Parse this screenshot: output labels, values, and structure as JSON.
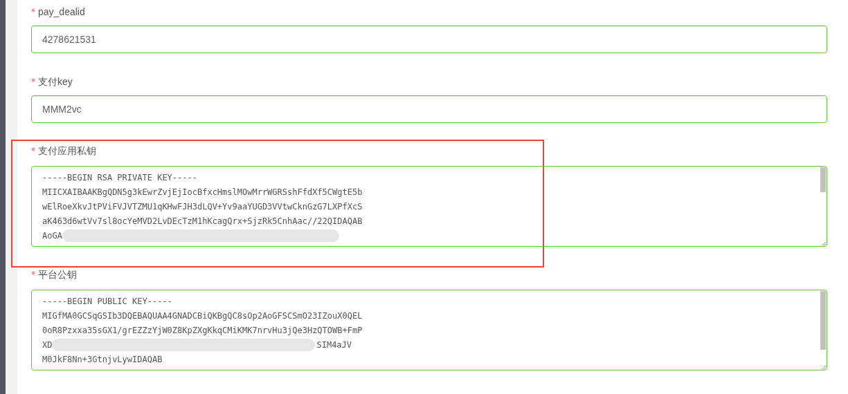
{
  "fields": [
    {
      "kind": "input",
      "label": "pay_dealid",
      "required": true,
      "value": "4278621531",
      "highlighted": false
    },
    {
      "kind": "input",
      "label": "支付key",
      "required": true,
      "value": "MMM2vc",
      "highlighted": false
    },
    {
      "kind": "textarea",
      "label": "支付应用私钥",
      "required": true,
      "highlighted": true,
      "lines": [
        {
          "kind": "text",
          "text": "-----BEGIN RSA PRIVATE KEY-----"
        },
        {
          "kind": "text",
          "text": "MIICXAIBAAKBgQDN5g3kEwrZvjEjIocBfxcHmslMOwMrrWGRSshFfdXf5CWgtE5b"
        },
        {
          "kind": "text",
          "text": "wElRoeXkvJtPViFVJVTZMU1qKHwFJH3dLQV+Yv9aaYUGD3VVtwCknGzG7LXPfXcS"
        },
        {
          "kind": "text",
          "text": "aK463d6wtVv7sl8ocYeMVD2LvDEcTzM1hKcagQrx+SjzRk5CnhAac//22QIDAQAB"
        },
        {
          "kind": "redacted",
          "left": "AoGA"
        }
      ]
    },
    {
      "kind": "textarea",
      "label": "平台公钥",
      "required": true,
      "highlighted": false,
      "lines": [
        {
          "kind": "text",
          "text": "-----BEGIN PUBLIC KEY-----"
        },
        {
          "kind": "text",
          "text": "MIGfMA0GCSqGSIb3DQEBAQUAA4GNADCBiQKBgQC8sOp2AoGFSCSmO23IZouX0QEL"
        },
        {
          "kind": "text",
          "text": "0oR8Pzxxa35sGX1/grEZZzYjW0Z8KpZXgKkqCMiKMK7nrvHu3jQe3HzQTOWB+FmP"
        },
        {
          "kind": "redacted",
          "left": "XD",
          "right": "SIM4aJV"
        },
        {
          "kind": "text",
          "text": "M0JkF8Nn+3GtnjvLywIDAQAB"
        }
      ]
    }
  ]
}
